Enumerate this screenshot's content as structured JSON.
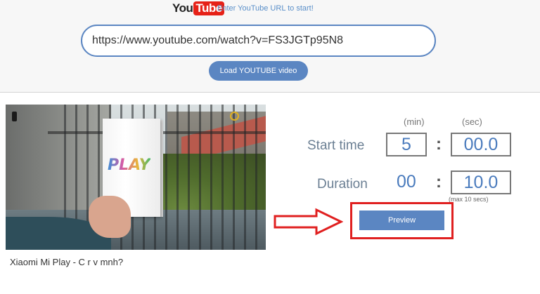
{
  "header": {
    "logo": {
      "you": "You",
      "tube": "Tube"
    },
    "tagline": "Enter YouTube URL to start!",
    "url_input": {
      "value": "https://www.youtube.com/watch?v=FS3JGTp95N8"
    },
    "load_button_label": "Load YOUTUBE video"
  },
  "video": {
    "title": "Xiaomi Mi Play - C r v mnh?",
    "thumbnail_text": "PLAY"
  },
  "controls": {
    "unit_min": "(min)",
    "unit_sec": "(sec)",
    "start_time": {
      "label": "Start time",
      "min": "5",
      "colon": ":",
      "sec": "00.0"
    },
    "duration": {
      "label": "Duration",
      "min": "00",
      "colon": ":",
      "sec": "10.0",
      "note": "(max 10 secs)"
    },
    "preview_button_label": "Preview"
  },
  "colors": {
    "accent": "#5b86c2",
    "value_text": "#4a7bbd",
    "highlight": "#e02020",
    "youtube_red": "#e62117"
  }
}
